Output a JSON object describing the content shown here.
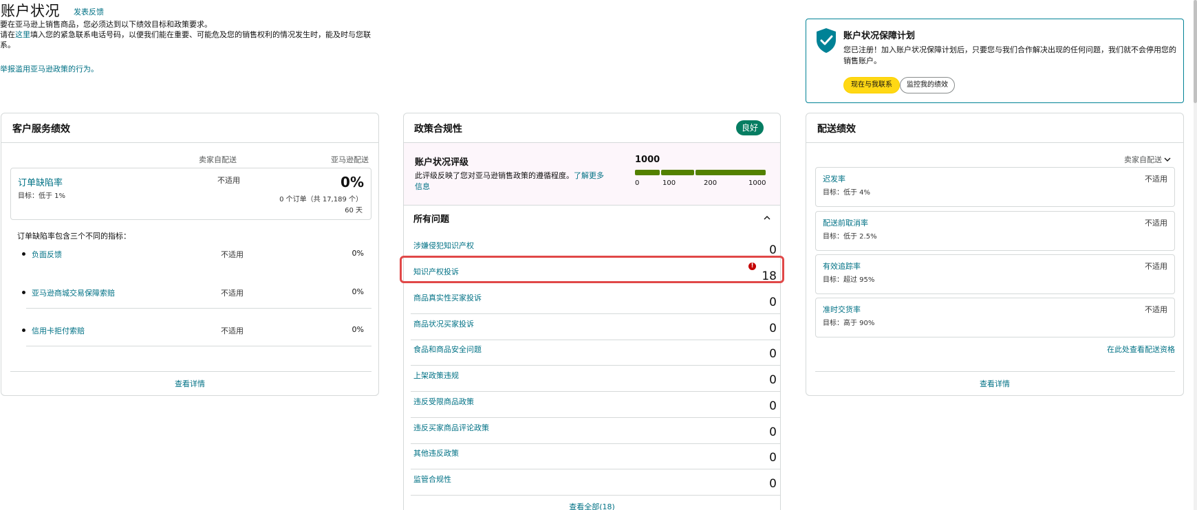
{
  "header": {
    "title": "账户状况",
    "feedback_link": "发表反馈",
    "intro_line1": "要在亚马逊上销售商品，您必须达到以下绩效目标和政策要求。",
    "intro_line2_prefix": "请在",
    "intro_line2_link": "这里",
    "intro_line2_suffix": "填入您的紧急联系电话号码，以便我们能在重要、可能危及您的销售权利的情况发生时，能及时与您联系。",
    "report_link": "举报滥用亚马逊政策的行为。"
  },
  "protection": {
    "title": "账户状况保障计划",
    "text": "您已注册！加入账户状况保障计划后，只要您与我们合作解决出现的任何问题，我们就不会停用您的销售账户。",
    "contact_button": "现在与我联系",
    "monitor_button": "监控我的绩效"
  },
  "customer_service": {
    "title": "客户服务绩效",
    "col_seller": "卖家自配送",
    "col_amazon": "亚马逊配送",
    "odr": {
      "label": "订单缺陷率",
      "goal": "目标：低于 1%",
      "seller_value": "不适用",
      "amazon_value": "0%",
      "orders": "0 个订单（共 17,189 个）",
      "days": "60 天"
    },
    "note": "订单缺陷率包含三个不同的指标：",
    "metrics": [
      {
        "label": "负面反馈",
        "seller": "不适用",
        "amazon": "0%"
      },
      {
        "label": "亚马逊商城交易保障索赔",
        "seller": "不适用",
        "amazon": "0%"
      },
      {
        "label": "信用卡拒付索赔",
        "seller": "不适用",
        "amazon": "0%"
      }
    ],
    "details_link": "查看详情"
  },
  "policy": {
    "title": "政策合规性",
    "badge": "良好",
    "ahr": {
      "title": "账户状况评级",
      "desc": "此评级反映了您对亚马逊销售政策的遵循程度。",
      "learn_more": "了解更多信息",
      "score": "1000",
      "ticks": [
        "0",
        "100",
        "200",
        "1000"
      ]
    },
    "issues_title": "所有问题",
    "issues": [
      {
        "label": "涉嫌侵犯知识产权",
        "count": "0"
      },
      {
        "label": "知识产权投诉",
        "count": "18"
      },
      {
        "label": "商品真实性买家投诉",
        "count": "0"
      },
      {
        "label": "商品状况买家投诉",
        "count": "0"
      },
      {
        "label": "食品和商品安全问题",
        "count": "0"
      },
      {
        "label": "上架政策违规",
        "count": "0"
      },
      {
        "label": "违反受限商品政策",
        "count": "0"
      },
      {
        "label": "违反买家商品评论政策",
        "count": "0"
      },
      {
        "label": "其他违反政策",
        "count": "0"
      },
      {
        "label": "监管合规性",
        "count": "0"
      }
    ],
    "view_all": "查看全部(18)"
  },
  "shipping": {
    "title": "配送绩效",
    "filter": "卖家自配送",
    "metrics": [
      {
        "label": "迟发率",
        "goal": "目标：低于 4%",
        "value": "不适用"
      },
      {
        "label": "配送前取消率",
        "goal": "目标：低于 2.5%",
        "value": "不适用"
      },
      {
        "label": "有效追踪率",
        "goal": "目标：超过 95%",
        "value": "不适用"
      },
      {
        "label": "准时交货率",
        "goal": "目标：高于 90%",
        "value": "不适用"
      }
    ],
    "eligibility_link": "在此处查看配送资格",
    "details_link": "查看详情"
  },
  "colors": {
    "link": "#007185",
    "good_badge": "#067d62",
    "bar_green": "#538000",
    "alert_red": "#e04848",
    "teal_border": "#008296",
    "primary_button": "#ffd814"
  }
}
